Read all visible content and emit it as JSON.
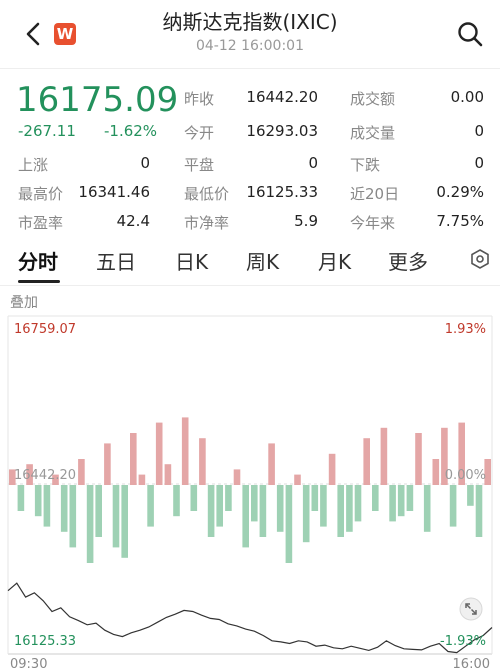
{
  "header": {
    "title": "纳斯达克指数(IXIC)",
    "datetime": "04-12 16:00:01",
    "logo_letter": "W",
    "back_icon": "chevron-left-icon",
    "search_icon": "search-icon"
  },
  "quote": {
    "price": "16175.09",
    "change": "-267.11",
    "change_pct": "-1.62%",
    "color_down": "#23915c",
    "color_up": "#c0392b"
  },
  "stats": {
    "prev_close_label": "昨收",
    "prev_close": "16442.20",
    "turnover_label": "成交额",
    "turnover": "0.00",
    "open_label": "今开",
    "open": "16293.03",
    "volume_label": "成交量",
    "volume": "0",
    "up_label": "上涨",
    "up": "0",
    "flat_label": "平盘",
    "flat": "0",
    "down_label": "下跌",
    "down": "0",
    "high_label": "最高价",
    "high": "16341.46",
    "low_label": "最低价",
    "low": "16125.33",
    "d20_label": "近20日",
    "d20": "0.29%",
    "pe_label": "市盈率",
    "pe": "42.4",
    "pb_label": "市净率",
    "pb": "5.9",
    "ytd_label": "今年来",
    "ytd": "7.75%"
  },
  "tabs": [
    "分时",
    "五日",
    "日K",
    "周K",
    "月K",
    "更多"
  ],
  "tabs_settings_icon": "hexagon-settings-icon",
  "overlay_label": "叠加",
  "chart_axis": {
    "top_value": "16759.07",
    "top_pct": "1.93%",
    "mid_value": "16442.20",
    "mid_pct": "0.00%",
    "bottom_value": "16125.33",
    "bottom_pct": "-1.93%",
    "time_start": "09:30",
    "time_end": "16:00"
  },
  "chart_data": {
    "type": "line",
    "x_range": [
      "09:30",
      "16:00"
    ],
    "ylim": [
      16125.33,
      16759.07
    ],
    "baseline": 16442.2,
    "price_series": [
      16244,
      16258,
      16232,
      16240,
      16225,
      16205,
      16212,
      16195,
      16188,
      16180,
      16183,
      16170,
      16162,
      16158,
      16165,
      16170,
      16176,
      16185,
      16194,
      16200,
      16207,
      16205,
      16198,
      16192,
      16190,
      16182,
      16178,
      16172,
      16168,
      16160,
      16150,
      16148,
      16145,
      16150,
      16148,
      16140,
      16142,
      16137,
      16135,
      16140,
      16136,
      16132,
      16138,
      16150,
      16141,
      16135,
      16134,
      16133,
      16140,
      16145,
      16130,
      16128,
      16140,
      16152,
      16160,
      16175
    ],
    "histogram_series": [
      0.03,
      -0.05,
      0.04,
      -0.06,
      -0.08,
      0.02,
      -0.09,
      -0.12,
      0.05,
      -0.15,
      -0.1,
      0.08,
      -0.12,
      -0.14,
      0.1,
      0.02,
      -0.08,
      0.12,
      0.04,
      -0.06,
      0.13,
      -0.05,
      0.09,
      -0.1,
      -0.08,
      -0.05,
      0.03,
      -0.12,
      -0.07,
      -0.1,
      0.08,
      -0.09,
      -0.15,
      0.02,
      -0.11,
      -0.05,
      -0.08,
      0.06,
      -0.1,
      -0.09,
      -0.07,
      0.09,
      -0.05,
      0.11,
      -0.07,
      -0.06,
      -0.05,
      0.1,
      -0.09,
      0.05,
      0.11,
      -0.08,
      0.12,
      -0.04,
      -0.1,
      0.05
    ]
  }
}
